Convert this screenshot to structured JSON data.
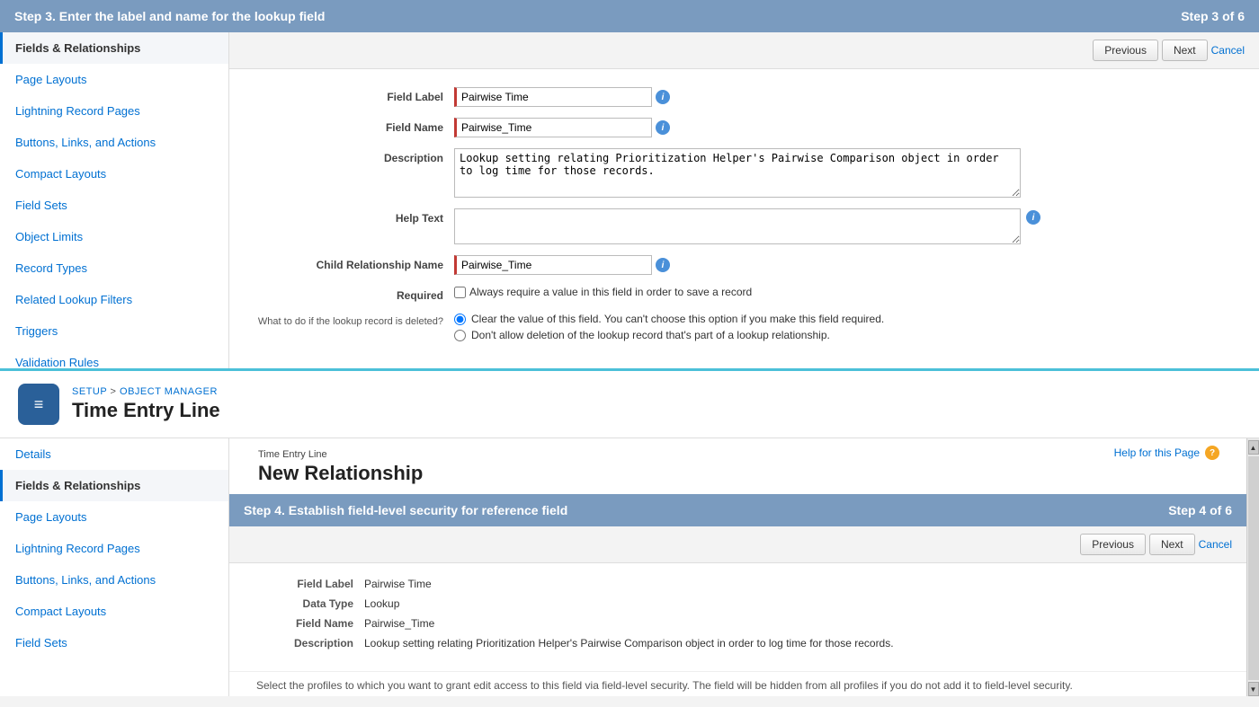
{
  "topPane": {
    "stepHeader": "Step 3. Enter the label and name for the lookup field",
    "stepLabel": "Step 3 of 6",
    "toolbar": {
      "previous": "Previous",
      "next": "Next",
      "cancel": "Cancel"
    },
    "form": {
      "fieldLabelLabel": "Field Label",
      "fieldLabelValue": "Pairwise Time",
      "fieldNameLabel": "Field Name",
      "fieldNameValue": "Pairwise_Time",
      "descriptionLabel": "Description",
      "descriptionValue": "Lookup setting relating Prioritization Helper's Pairwise Comparison object in order to log time for those records.",
      "helpTextLabel": "Help Text",
      "helpTextValue": "",
      "childRelNameLabel": "Child Relationship Name",
      "childRelNameValue": "Pairwise_Time",
      "requiredLabel": "Required",
      "requiredCheckboxLabel": "Always require a value in this field in order to save a record",
      "deletedLabel": "What to do if the lookup record is deleted?",
      "radio1": "Clear the value of this field. You can't choose this option if you make this field required.",
      "radio2": "Don't allow deletion of the lookup record that's part of a lookup relationship."
    }
  },
  "objectHeader": {
    "breadcrumb": {
      "setup": "SETUP",
      "separator": " > ",
      "objectManager": "OBJECT MANAGER"
    },
    "title": "Time Entry Line",
    "iconSymbol": "≡"
  },
  "sidebar": {
    "items": [
      {
        "id": "details",
        "label": "Details",
        "active": false
      },
      {
        "id": "fields-relationships",
        "label": "Fields & Relationships",
        "active": true
      },
      {
        "id": "page-layouts",
        "label": "Page Layouts",
        "active": false
      },
      {
        "id": "lightning-record-pages",
        "label": "Lightning Record Pages",
        "active": false
      },
      {
        "id": "buttons-links-actions",
        "label": "Buttons, Links, and Actions",
        "active": false
      },
      {
        "id": "compact-layouts",
        "label": "Compact Layouts",
        "active": false
      },
      {
        "id": "field-sets",
        "label": "Field Sets",
        "active": false
      },
      {
        "id": "object-limits",
        "label": "Object Limits",
        "active": false
      },
      {
        "id": "record-types",
        "label": "Record Types",
        "active": false
      },
      {
        "id": "related-lookup-filters",
        "label": "Related Lookup Filters",
        "active": false
      },
      {
        "id": "triggers",
        "label": "Triggers",
        "active": false
      },
      {
        "id": "validation-rules",
        "label": "Validation Rules",
        "active": false
      }
    ]
  },
  "topSidebar": {
    "items": [
      {
        "id": "top-fields-relationships",
        "label": "Fields & Relationships",
        "active": true
      },
      {
        "id": "top-page-layouts",
        "label": "Page Layouts",
        "active": false
      },
      {
        "id": "top-lightning-record-pages",
        "label": "Lightning Record Pages",
        "active": false
      },
      {
        "id": "top-buttons-links-actions",
        "label": "Buttons, Links, and Actions",
        "active": false
      },
      {
        "id": "top-compact-layouts",
        "label": "Compact Layouts",
        "active": false
      },
      {
        "id": "top-field-sets",
        "label": "Field Sets",
        "active": false
      },
      {
        "id": "top-object-limits",
        "label": "Object Limits",
        "active": false
      },
      {
        "id": "top-record-types",
        "label": "Record Types",
        "active": false
      },
      {
        "id": "top-related-lookup-filters",
        "label": "Related Lookup Filters",
        "active": false
      },
      {
        "id": "top-triggers",
        "label": "Triggers",
        "active": false
      },
      {
        "id": "top-validation-rules",
        "label": "Validation Rules",
        "active": false
      }
    ]
  },
  "bottomPane": {
    "breadcrumb": "Time Entry Line",
    "title": "New Relationship",
    "helpLink": "Help for this Page",
    "stepHeader": "Step 4. Establish field-level security for reference field",
    "stepLabel": "Step 4 of 6",
    "toolbar": {
      "previous": "Previous",
      "next": "Next",
      "cancel": "Cancel"
    },
    "form": {
      "fieldLabelLabel": "Field Label",
      "fieldLabelValue": "Pairwise Time",
      "dataTypeLabel": "Data Type",
      "dataTypeValue": "Lookup",
      "fieldNameLabel": "Field Name",
      "fieldNameValue": "Pairwise_Time",
      "descriptionLabel": "Description",
      "descriptionValue": "Lookup setting relating Prioritization Helper's Pairwise Comparison object in order to log time for those records."
    },
    "securityNote": "Select the profiles to which you want to grant edit access to this field via field-level security. The field will be hidden from all profiles if you do not add it to field-level security."
  }
}
